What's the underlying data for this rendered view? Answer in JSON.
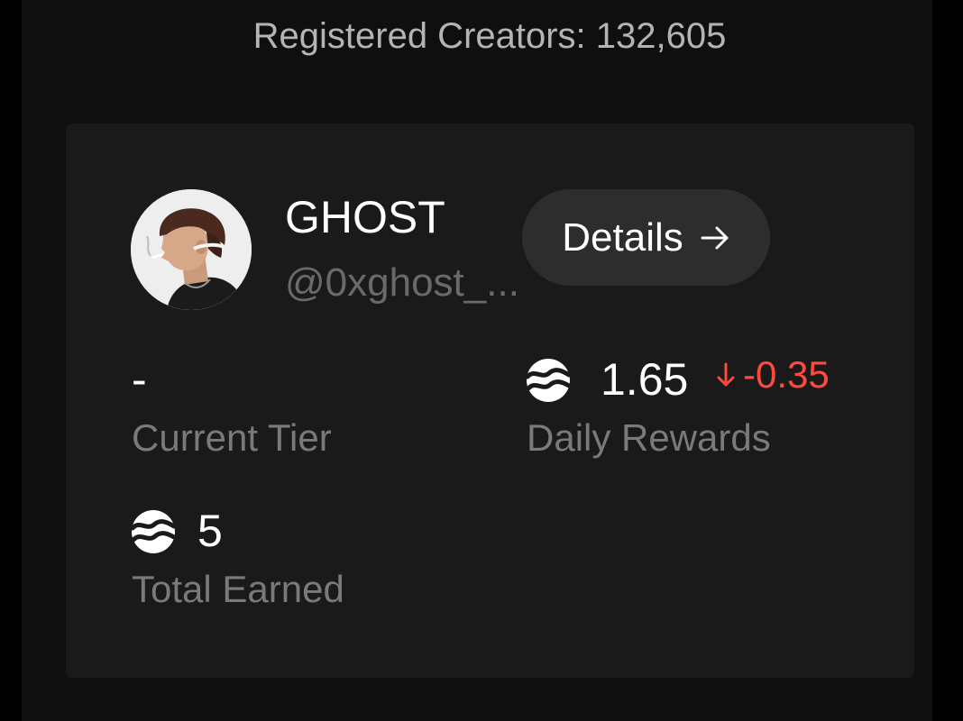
{
  "header": {
    "registered_creators": "Registered Creators: 132,605"
  },
  "profile": {
    "display_name": "GHOST",
    "handle": "@0xghost_...",
    "details_label": "Details",
    "avatar_icon": "user-avatar"
  },
  "stats": {
    "tier": {
      "value": "-",
      "label": "Current Tier"
    },
    "daily_rewards": {
      "value": "1.65",
      "change": "-0.35",
      "change_direction": "down",
      "label": "Daily Rewards",
      "token_icon": "token-icon"
    },
    "total_earned": {
      "value": "5",
      "label": "Total Earned",
      "token_icon": "token-icon"
    }
  },
  "colors": {
    "background": "#000000",
    "panel": "#0f0f0f",
    "card": "#1a1a1a",
    "button": "#2d2d2d",
    "negative": "#ff4a3d",
    "muted_text": "#7a7a7a"
  }
}
